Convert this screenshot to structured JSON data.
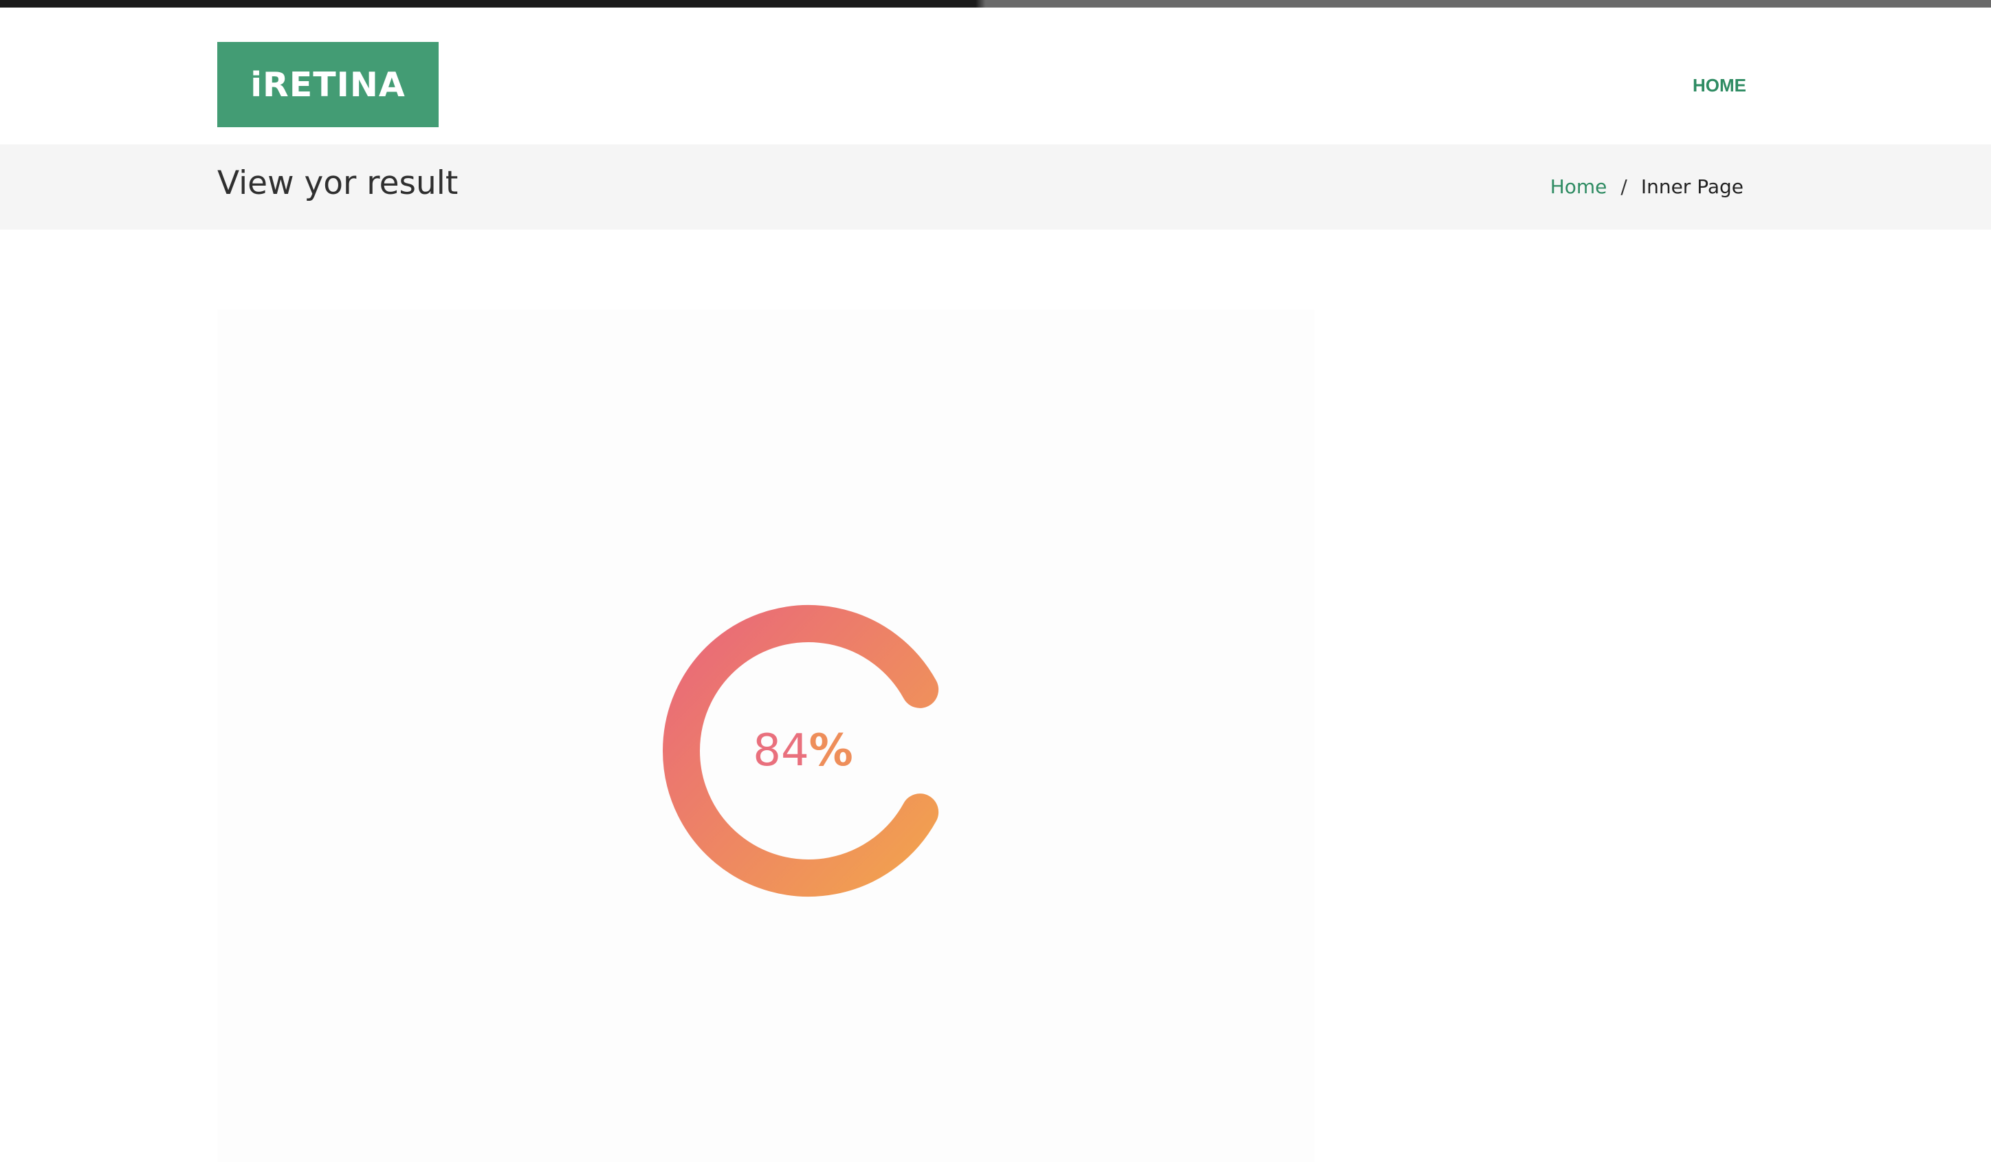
{
  "brand": {
    "logo_text": "iRETINA",
    "color": "#439c74"
  },
  "nav": {
    "home_label": "HOME",
    "color": "#2e8b62"
  },
  "page": {
    "title": "View yor result"
  },
  "breadcrumb": {
    "home_label": "Home",
    "separator": "/",
    "current_label": "Inner Page",
    "link_color": "#2e8b62"
  },
  "result": {
    "percent_value": "84",
    "percent_sign": "%",
    "fraction": 0.84,
    "gradient_start": "#e9687a",
    "gradient_end": "#f2a24e"
  }
}
